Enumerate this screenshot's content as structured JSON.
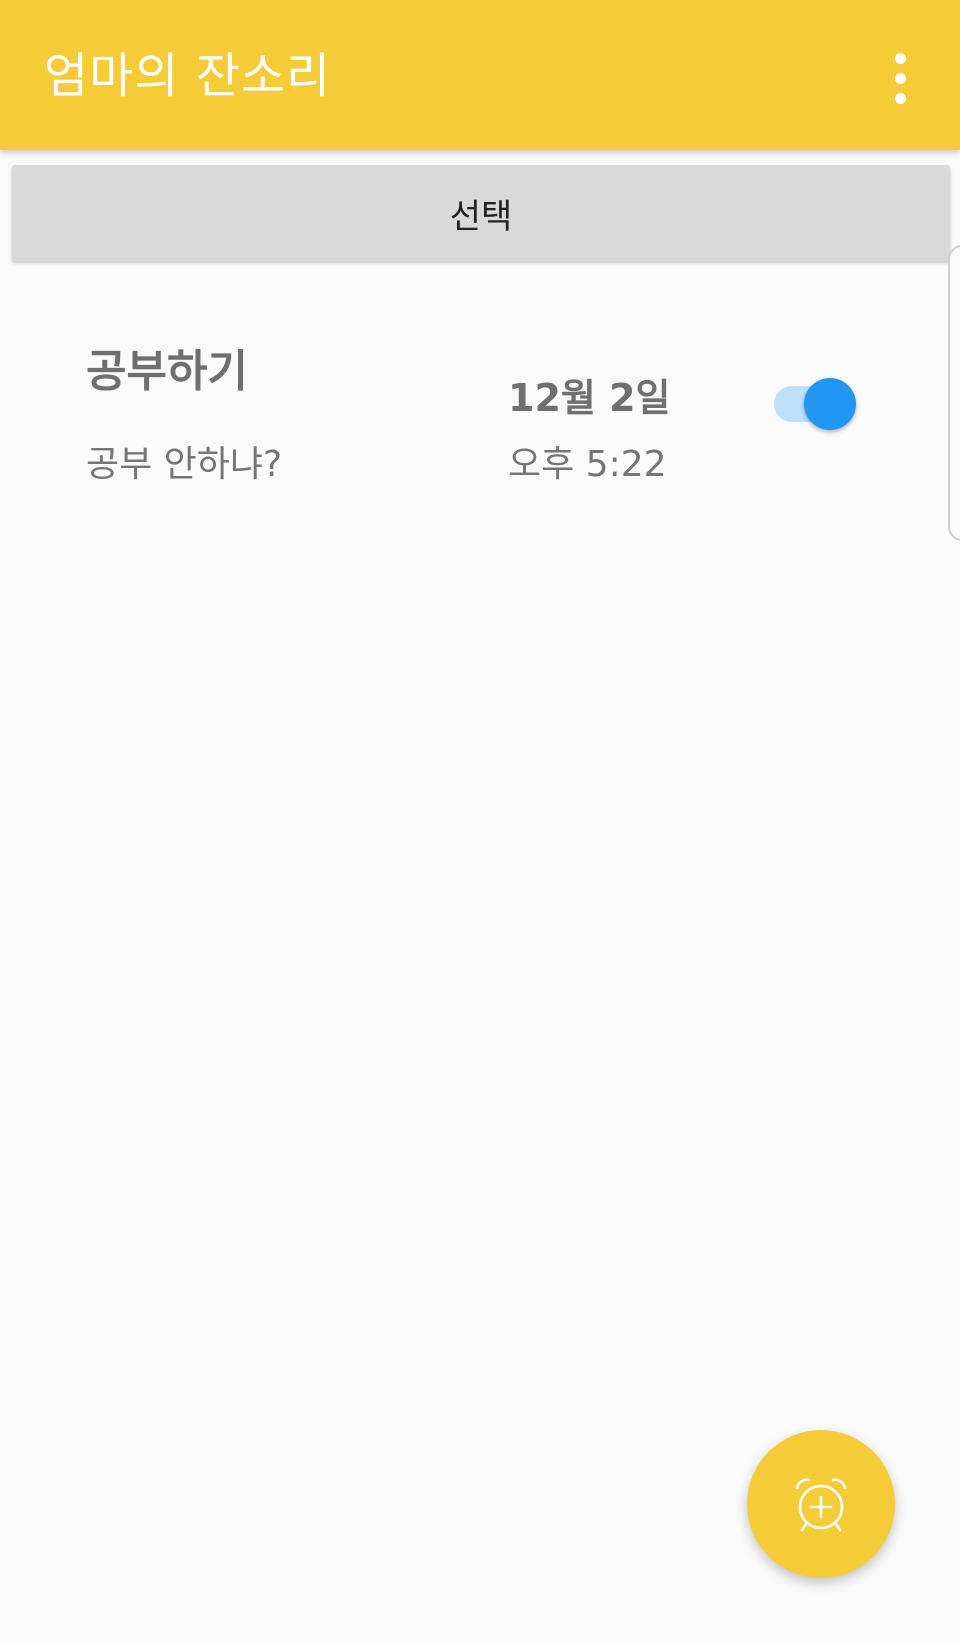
{
  "appbar": {
    "title": "엄마의 잔소리",
    "menu_icon": "more-vert-icon"
  },
  "select_button": {
    "label": "선택"
  },
  "alarms": [
    {
      "title": "공부하기",
      "message": "공부 안하냐?",
      "date": "12월 2일",
      "time": "오후 5:22",
      "enabled": true
    }
  ],
  "fab": {
    "icon": "add-alarm-icon"
  },
  "colors": {
    "primary": "#f6cb38",
    "accent": "#2196f3",
    "toggle_track": "#bfe0fb",
    "background": "#fafafa"
  }
}
